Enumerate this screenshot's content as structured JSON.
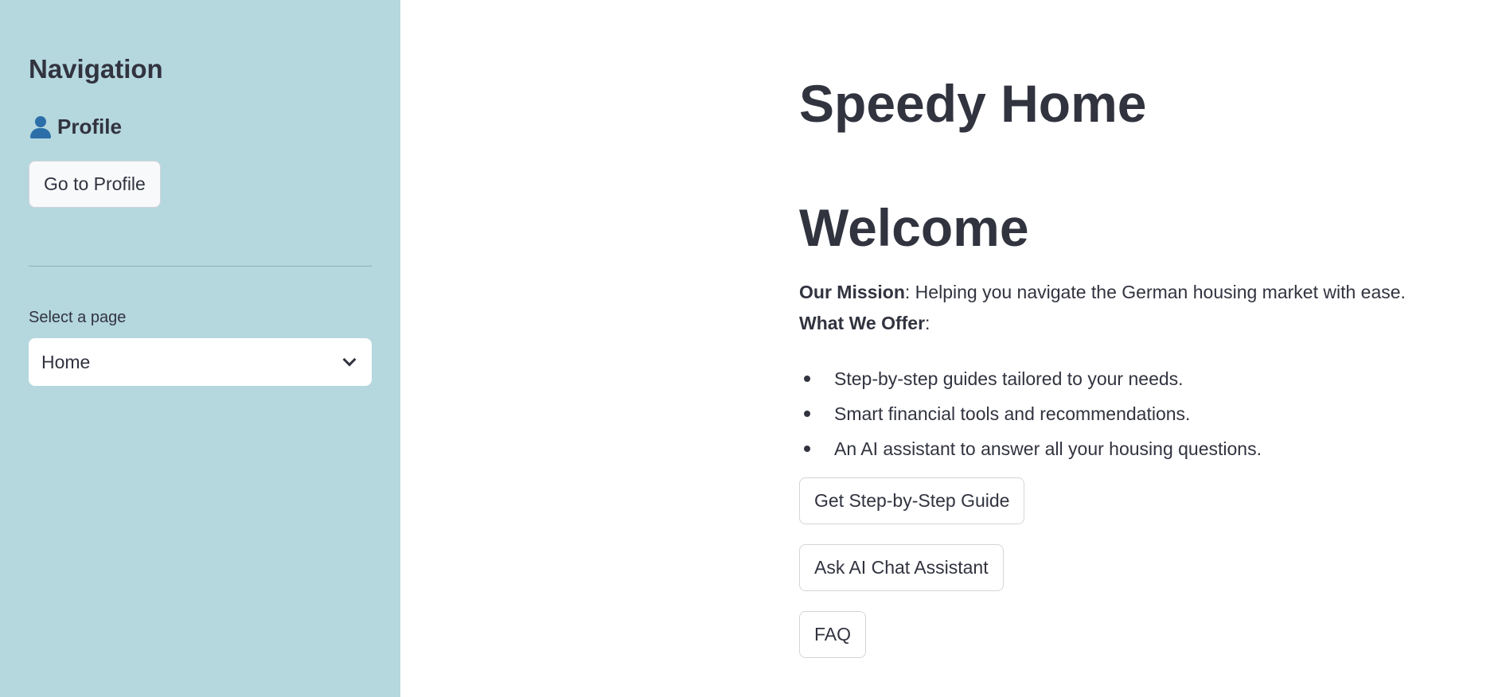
{
  "sidebar": {
    "title": "Navigation",
    "profile_heading": "Profile",
    "profile_icon": "person-icon",
    "go_to_profile_label": "Go to Profile",
    "select_label": "Select a page",
    "select_value": "Home",
    "background_color": "#b5d7de"
  },
  "main": {
    "app_title": "Speedy Home",
    "welcome_heading": "Welcome",
    "mission_label": "Our Mission",
    "mission_text": ": Helping you navigate the German housing market with ease.",
    "offer_label": "What We Offer",
    "offer_suffix": ":",
    "offers": [
      "Step-by-step guides tailored to your needs.",
      "Smart financial tools and recommendations.",
      "An AI assistant to answer all your housing questions."
    ],
    "buttons": {
      "guide": "Get Step-by-Step Guide",
      "ai_chat": "Ask AI Chat Assistant",
      "faq": "FAQ"
    }
  }
}
